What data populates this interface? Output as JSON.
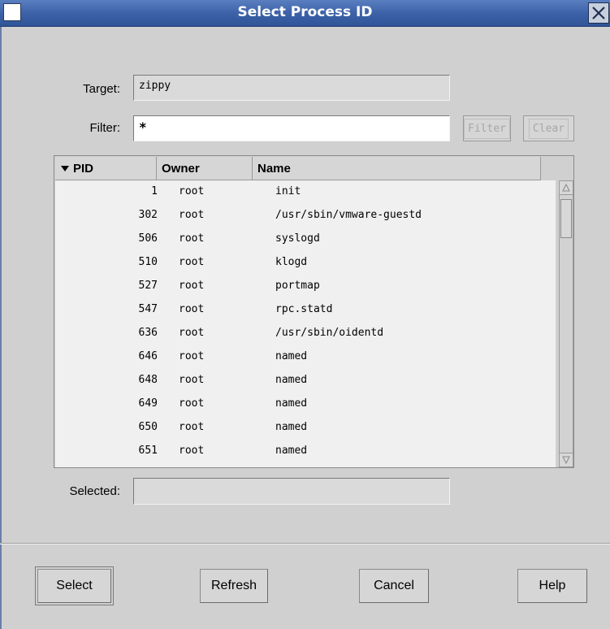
{
  "window": {
    "title": "Select Process ID"
  },
  "form": {
    "target_label": "Target:",
    "target_value": "zippy",
    "filter_label": "Filter:",
    "filter_value": "*",
    "filter_button": "Filter",
    "clear_button": "Clear",
    "selected_label": "Selected:",
    "selected_value": ""
  },
  "table": {
    "columns": [
      "PID",
      "Owner",
      "Name"
    ],
    "sort_column": "PID",
    "sort_direction": "descending-arrow",
    "rows": [
      {
        "pid": "1",
        "owner": "root",
        "name": "init"
      },
      {
        "pid": "302",
        "owner": "root",
        "name": "/usr/sbin/vmware-guestd"
      },
      {
        "pid": "506",
        "owner": "root",
        "name": "syslogd"
      },
      {
        "pid": "510",
        "owner": "root",
        "name": "klogd"
      },
      {
        "pid": "527",
        "owner": "root",
        "name": "portmap"
      },
      {
        "pid": "547",
        "owner": "root",
        "name": "rpc.statd"
      },
      {
        "pid": "636",
        "owner": "root",
        "name": "/usr/sbin/oidentd"
      },
      {
        "pid": "646",
        "owner": "root",
        "name": "named"
      },
      {
        "pid": "648",
        "owner": "root",
        "name": "named"
      },
      {
        "pid": "649",
        "owner": "root",
        "name": "named"
      },
      {
        "pid": "650",
        "owner": "root",
        "name": "named"
      },
      {
        "pid": "651",
        "owner": "root",
        "name": "named"
      }
    ]
  },
  "buttons": {
    "select": "Select",
    "refresh": "Refresh",
    "cancel": "Cancel",
    "help": "Help"
  },
  "icons": {
    "close": "close-icon",
    "sort": "sort-down-arrow-icon",
    "scroll_up": "scroll-up-arrow-icon",
    "scroll_down": "scroll-down-arrow-icon"
  },
  "colors": {
    "titlebar": "#3d62a8",
    "window_bg": "#d0d0d0",
    "list_bg": "#f0f0f0"
  }
}
